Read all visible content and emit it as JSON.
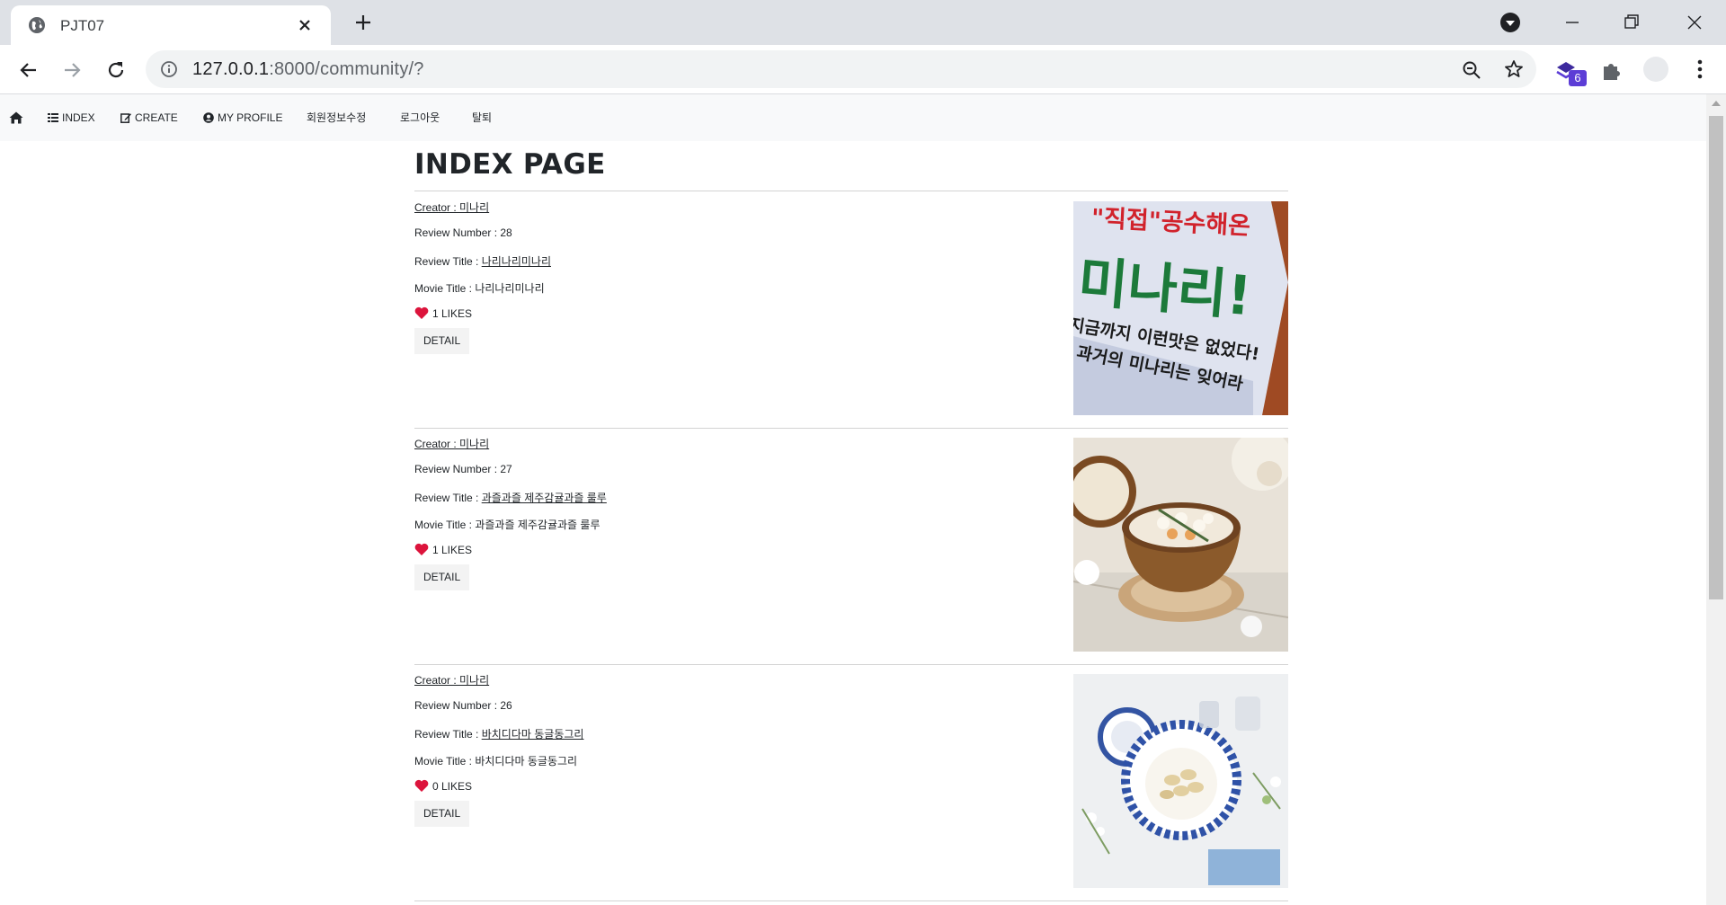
{
  "browser": {
    "tab_title": "PJT07",
    "url_host": "127.0.0.1",
    "url_path": ":8000/community/?",
    "extension_badge": "6"
  },
  "site_nav": {
    "items": [
      {
        "label": "INDEX",
        "icon": "list-icon"
      },
      {
        "label": "CREATE",
        "icon": "edit-icon"
      },
      {
        "label": "MY PROFILE",
        "icon": "user-circle-icon"
      },
      {
        "label": "회원정보수정"
      },
      {
        "label": "로그아웃"
      },
      {
        "label": "탈퇴"
      }
    ]
  },
  "page": {
    "heading": "INDEX PAGE"
  },
  "reviews": [
    {
      "creator_label": "Creator : 미나리",
      "number_label": "Review Number : 28",
      "title_prefix": "Review Title : ",
      "title": "나리나리미나리",
      "movie_label": "Movie Title : 나리나리미나리",
      "likes": "1 LIKES",
      "detail": "DETAIL",
      "image_text": {
        "line1": "\"직접\"공수해온",
        "line2": "미나리!",
        "line3": "지금까지 이런맛은 없었다!",
        "line4": "과거의 미나리는 잊어라"
      }
    },
    {
      "creator_label": "Creator : 미나리",
      "number_label": "Review Number : 27",
      "title_prefix": "Review Title : ",
      "title": "과즐과즐 제주감귤과즐 룰루",
      "movie_label": "Movie Title : 과즐과즐 제주감귤과즐 룰루",
      "likes": "1 LIKES",
      "detail": "DETAIL"
    },
    {
      "creator_label": "Creator : 미나리",
      "number_label": "Review Number : 26",
      "title_prefix": "Review Title : ",
      "title": "바치디다마 동글동그리",
      "movie_label": "Movie Title : 바치디다마 동글동그리",
      "likes": "0 LIKES",
      "detail": "DETAIL"
    }
  ],
  "colors": {
    "heart": "#dc143c",
    "nav_bg": "#f8f9fa",
    "tabstrip": "#dee1e6",
    "accent_ext": "#5c3dd6"
  }
}
